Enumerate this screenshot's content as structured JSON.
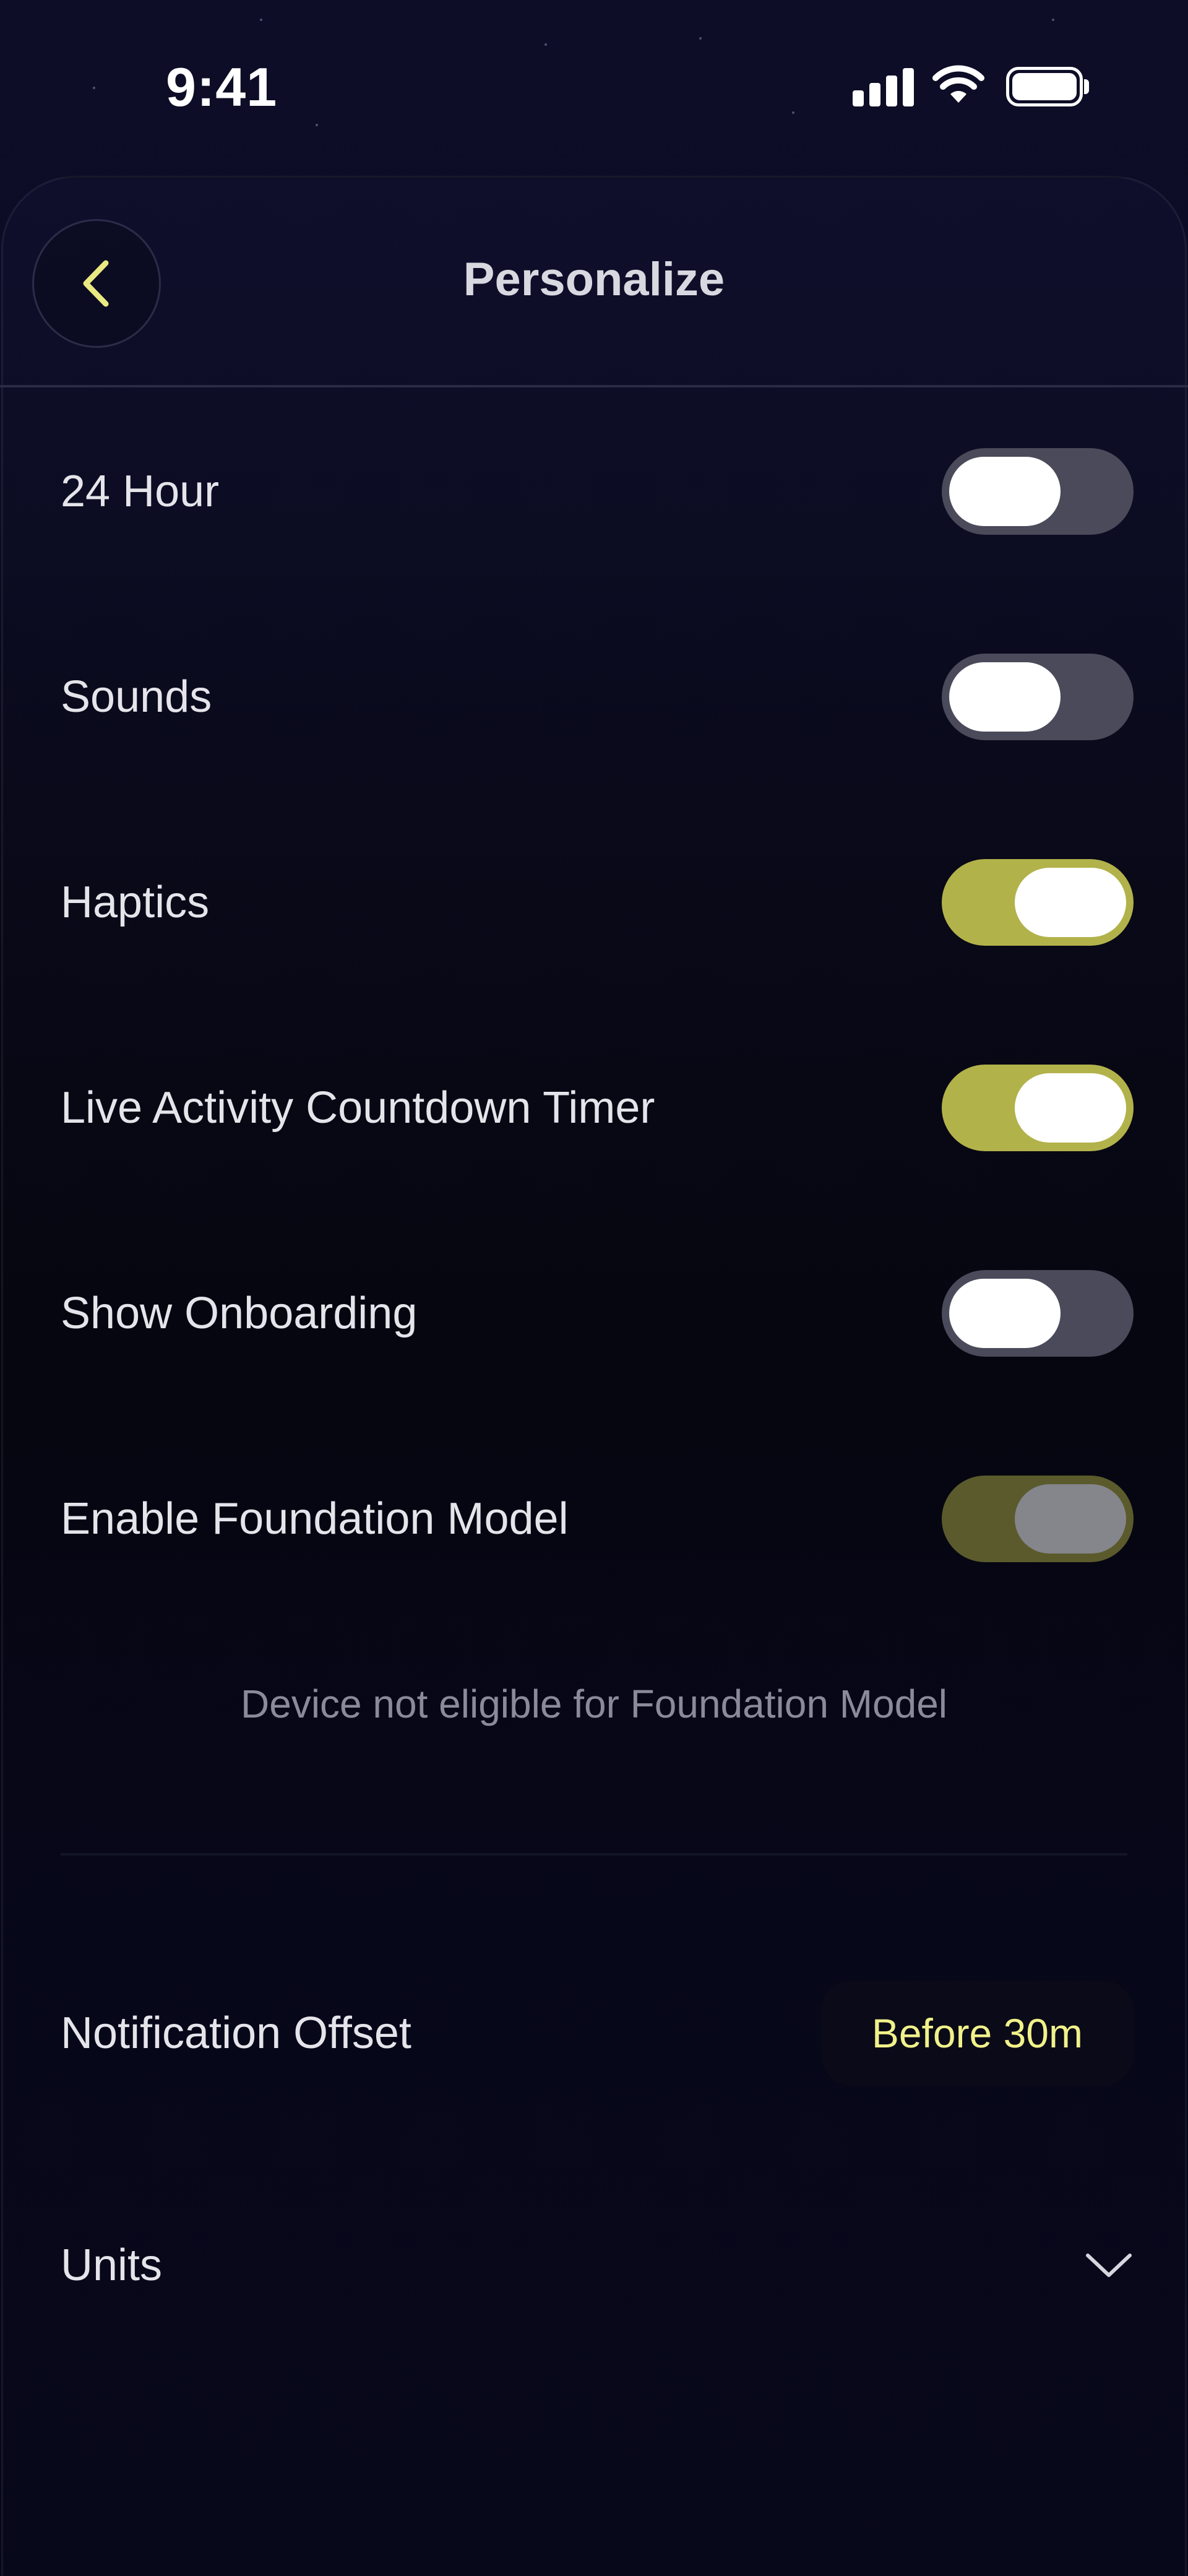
{
  "status_bar": {
    "time": "9:41",
    "icons": [
      "signal-icon",
      "wifi-icon",
      "battery-icon"
    ]
  },
  "nav": {
    "title": "Personalize",
    "back_icon": "chevron-left-icon"
  },
  "settings": {
    "hour24": {
      "label": "24 Hour",
      "state": "off"
    },
    "sounds": {
      "label": "Sounds",
      "state": "off"
    },
    "haptics": {
      "label": "Haptics",
      "state": "on"
    },
    "live_activity": {
      "label": "Live Activity Countdown Timer",
      "state": "on"
    },
    "show_onboarding": {
      "label": "Show Onboarding",
      "state": "off"
    },
    "foundation_model": {
      "label": "Enable Foundation Model",
      "state": "on-disabled"
    }
  },
  "foundation_note": "Device not eligible for Foundation Model",
  "notification_offset": {
    "label": "Notification Offset",
    "value": "Before 30m"
  },
  "units": {
    "label": "Units",
    "icon": "chevron-down-icon"
  },
  "colors": {
    "accent": "#b2b24b",
    "accent_text": "#f1f18a",
    "toggle_off": "#4a4a5a",
    "background": "#07071a"
  }
}
